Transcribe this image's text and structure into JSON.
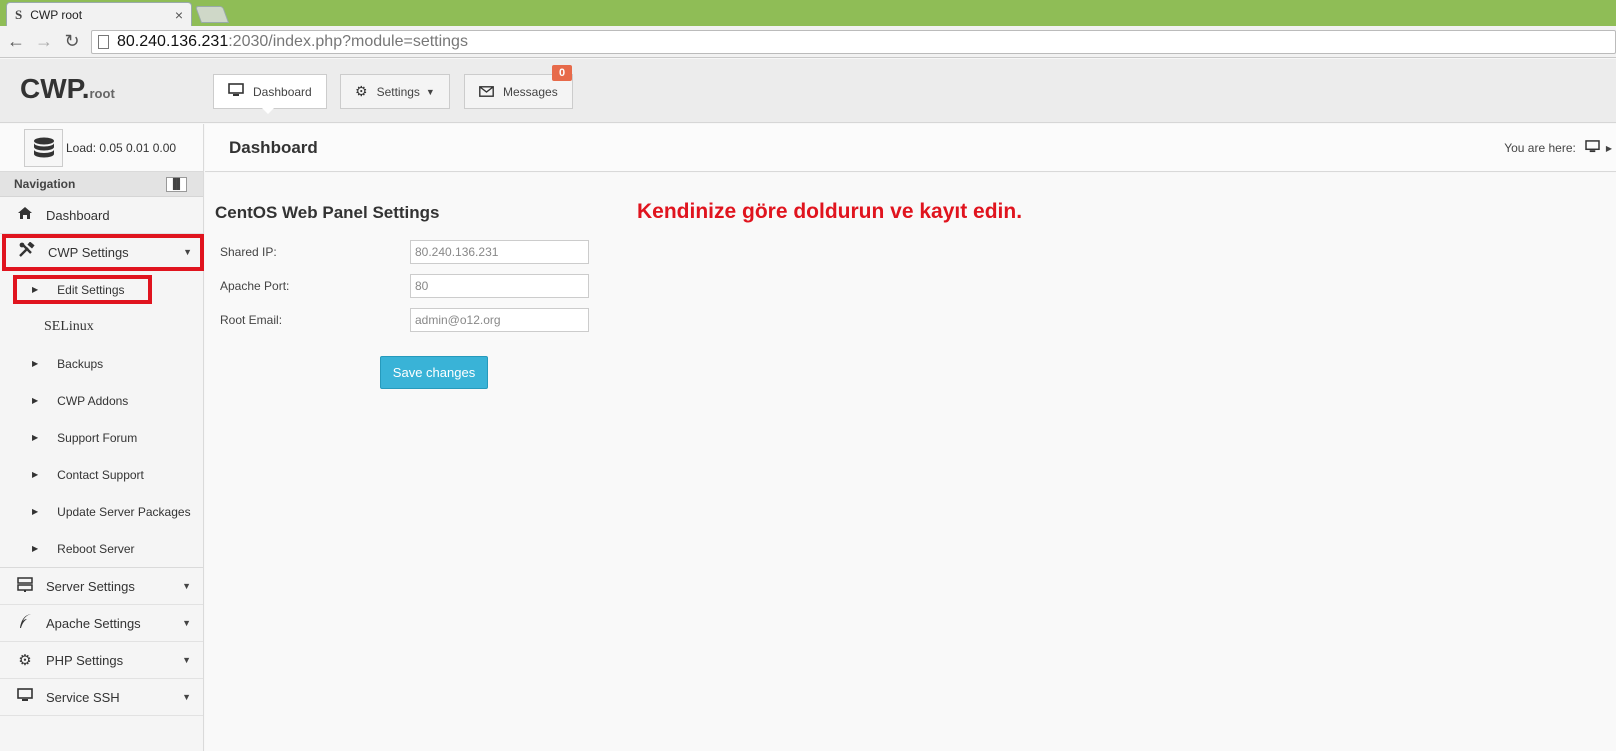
{
  "browser": {
    "tab_title": "CWP root",
    "tab_favicon": "S",
    "url_host": "80.240.136.231",
    "url_rest": ":2030/index.php?module=settings"
  },
  "header": {
    "logo_main": "CWP",
    "logo_dot": ".",
    "logo_sub": "root",
    "dashboard_label": "Dashboard",
    "settings_label": "Settings",
    "messages_label": "Messages",
    "messages_count": "0"
  },
  "sidebar": {
    "load_label": "Load: 0.05  0.01  0.00",
    "nav_heading": "Navigation",
    "items": [
      {
        "label": "Dashboard",
        "icon": "home-icon"
      },
      {
        "label": "CWP Settings",
        "icon": "tools-icon"
      },
      {
        "label": "Server Settings",
        "icon": "server-icon"
      },
      {
        "label": "Apache Settings",
        "icon": "feather-icon"
      },
      {
        "label": "PHP Settings",
        "icon": "gear-icon"
      },
      {
        "label": "Service SSH",
        "icon": "monitor-icon"
      }
    ],
    "sub_items": [
      "Edit Settings",
      "SELinux",
      "Backups",
      "CWP Addons",
      "Support Forum",
      "Contact Support",
      "Update Server Packages",
      "Reboot Server"
    ]
  },
  "main": {
    "title": "Dashboard",
    "breadcrumb_label": "You are here:",
    "panel_title": "CentOS Web Panel Settings",
    "annotation": "Kendinize göre doldurun ve kayıt edin.",
    "fields": [
      {
        "label": "Shared IP:",
        "value": "80.240.136.231"
      },
      {
        "label": "Apache Port:",
        "value": "80"
      },
      {
        "label": "Root Email:",
        "value": "admin@o12.org"
      }
    ],
    "save_label": "Save changes"
  },
  "colors": {
    "chrome_green": "#8fbd56",
    "annotation_red": "#e0141e",
    "badge_orange": "#e76a4a",
    "save_blue": "#39b3d7"
  }
}
